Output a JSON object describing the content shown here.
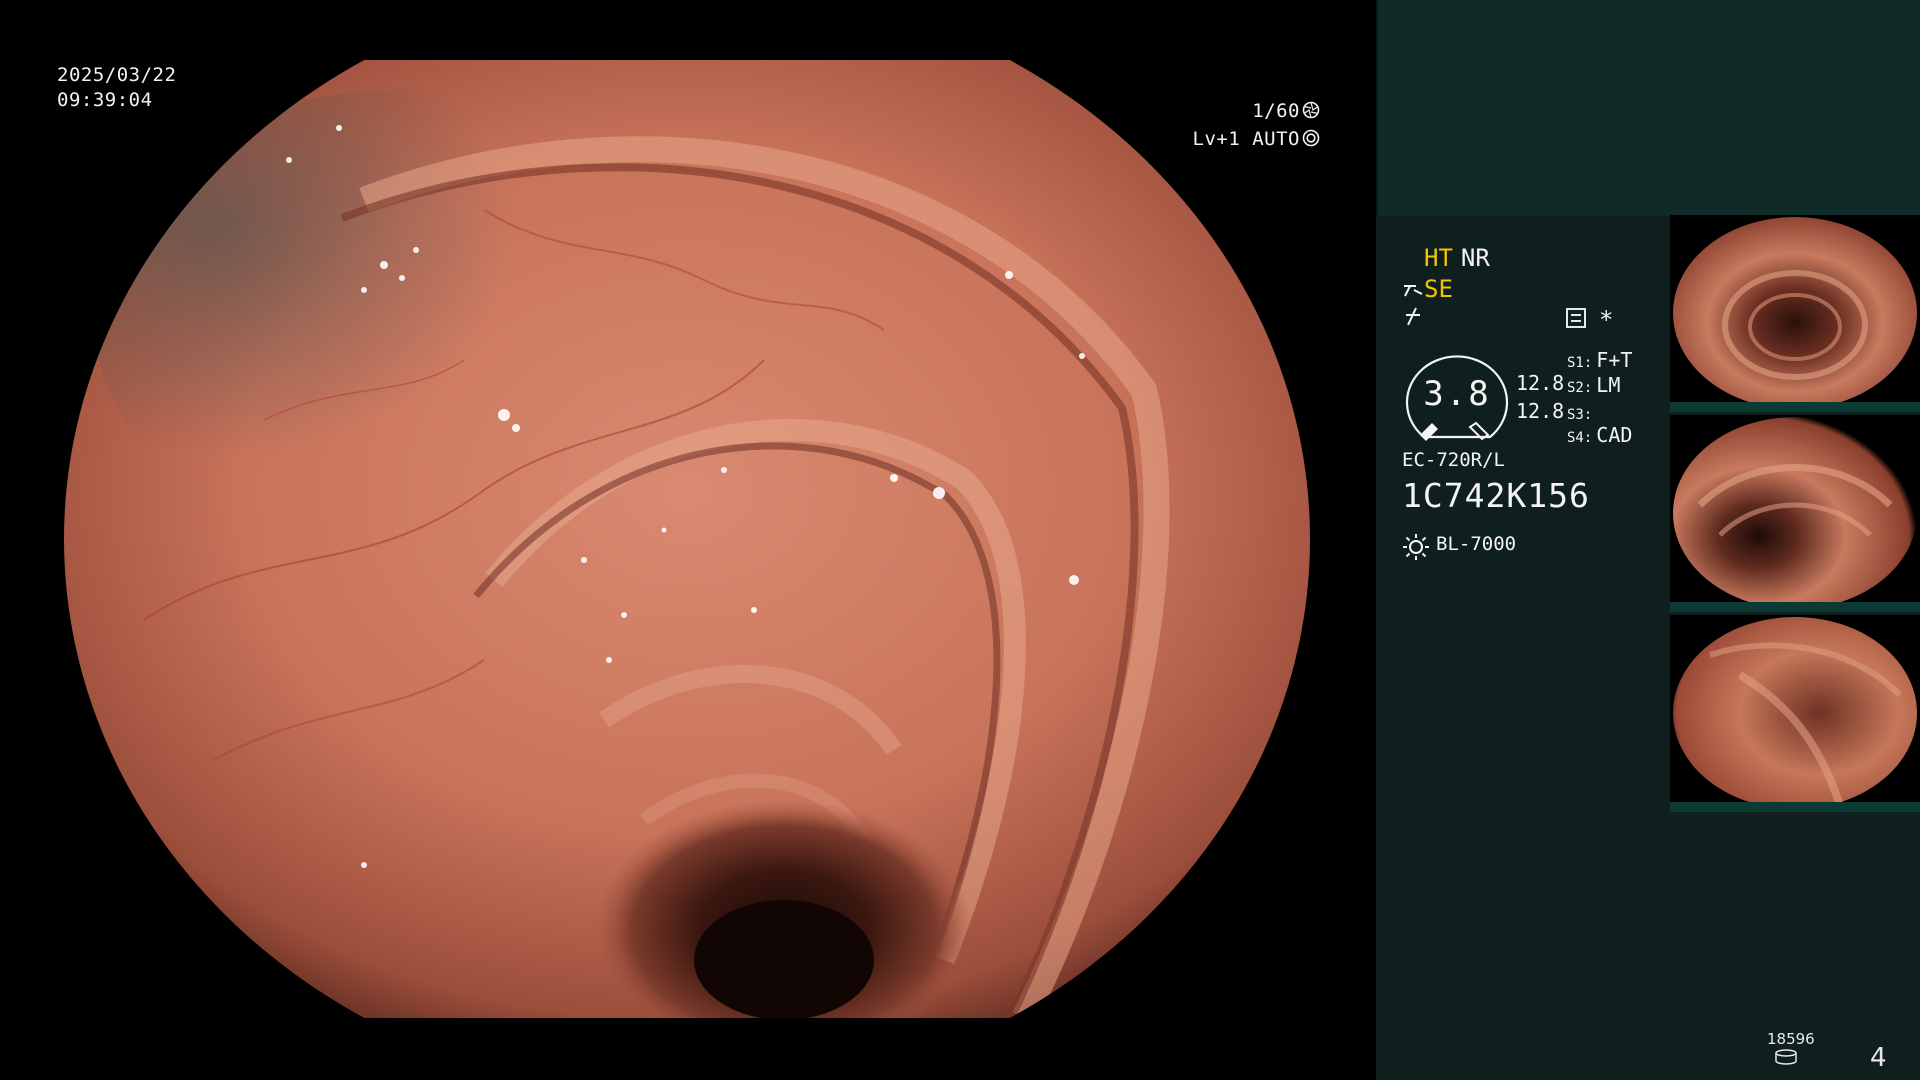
{
  "overlay": {
    "date": "2025/03/22",
    "time": "09:39:04",
    "shutter": "1/60",
    "level": "Lv+1 AUTO"
  },
  "panel": {
    "ht": "HT",
    "nr": "NR",
    "se": "SE",
    "star": "*",
    "zoom": "3.8",
    "exposure": [
      "12.8",
      "12.8"
    ],
    "switches": [
      {
        "label": "S1:",
        "value": "F+T"
      },
      {
        "label": "S2:",
        "value": "LM"
      },
      {
        "label": "S3:",
        "value": ""
      },
      {
        "label": "S4:",
        "value": "CAD"
      }
    ],
    "scope_model": "EC-720R/L",
    "scope_serial": "1C742K156",
    "light_source": "BL-7000",
    "image_count": "18596",
    "page": "4"
  },
  "colors": {
    "panel_bg": "#0f1f1e",
    "panel_top": "#0f2a27",
    "accent": "#f5c400",
    "tissue": "#c9745a"
  },
  "icons": {
    "shutter": "aperture-icon",
    "auto": "iris-icon",
    "se": "enhance-icon",
    "edge": "edge-icon",
    "structure": "structure-enhance-icon",
    "light": "sun-icon",
    "count": "disk-stack-icon"
  }
}
